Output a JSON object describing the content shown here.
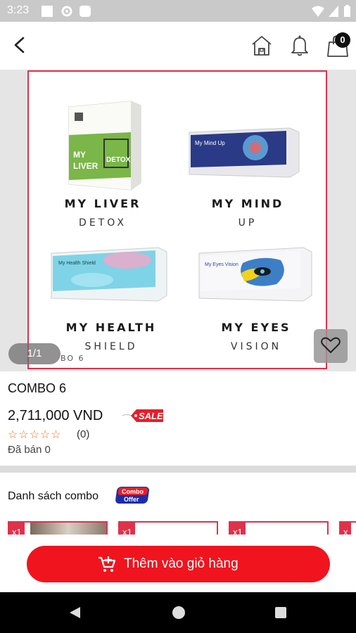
{
  "status_bar": {
    "time": "3:23"
  },
  "header": {
    "cart_count": "0"
  },
  "gallery": {
    "pager": "1/1",
    "caption": "BO 6",
    "products": [
      {
        "name": "MY LIVER",
        "sub": "DETOX",
        "box_text": "MY LIVER",
        "box_text2": "DETOX",
        "box_color": "#7ab648"
      },
      {
        "name": "MY MIND",
        "sub": "UP",
        "box_text": "My Mind Up",
        "box_color": "#2a3a86"
      },
      {
        "name": "MY HEALTH",
        "sub": "SHIELD",
        "box_text": "My Health Shield",
        "box_color": "#7fd3e6"
      },
      {
        "name": "MY EYES",
        "sub": "VISION",
        "box_text": "My Eyes Vision",
        "box_color": "#3c7fc7"
      }
    ]
  },
  "product": {
    "name": "COMBO 6",
    "price": "2,711,000 VND",
    "sale_tag": "SALE",
    "stars": "☆☆☆☆☆",
    "rating_count": "(0)",
    "sold": "Đã bán 0"
  },
  "combo_list": {
    "title": "Danh sách combo",
    "offer_badge_line1": "Combo",
    "offer_badge_line2": "Offer",
    "items": [
      {
        "qty": "x1"
      },
      {
        "qty": "x1"
      },
      {
        "qty": "x1"
      },
      {
        "qty": "x"
      }
    ]
  },
  "add_to_cart": {
    "label": "Thêm vào giỏ hàng"
  },
  "colors": {
    "accent": "#f0141e",
    "frame": "#e0314b",
    "star": "#e8751a"
  }
}
